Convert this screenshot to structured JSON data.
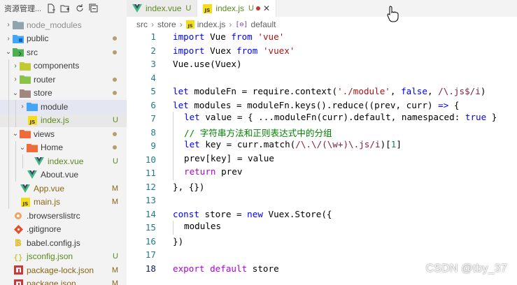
{
  "explorer": {
    "title": "资源管理...",
    "actions": [
      "new-file-icon",
      "new-folder-icon",
      "refresh-icon",
      "collapse-all-icon"
    ],
    "items": [
      {
        "label": "node_modules",
        "depth": 0,
        "kind": "folder",
        "open": false,
        "status": "",
        "color": "ignored"
      },
      {
        "label": "public",
        "depth": 0,
        "kind": "folder-public",
        "open": false,
        "status": "dot",
        "color": ""
      },
      {
        "label": "src",
        "depth": 0,
        "kind": "folder-src",
        "open": true,
        "status": "dot",
        "color": ""
      },
      {
        "label": "components",
        "depth": 1,
        "kind": "folder-components",
        "open": false,
        "status": "",
        "color": ""
      },
      {
        "label": "router",
        "depth": 1,
        "kind": "folder-router",
        "open": false,
        "status": "dot",
        "color": ""
      },
      {
        "label": "store",
        "depth": 1,
        "kind": "folder-store",
        "open": true,
        "status": "dot",
        "color": ""
      },
      {
        "label": "module",
        "depth": 2,
        "kind": "folder-module",
        "open": false,
        "status": "",
        "color": ""
      },
      {
        "label": "index.js",
        "depth": 2,
        "kind": "js",
        "open": false,
        "status": "U",
        "color": "git-u"
      },
      {
        "label": "views",
        "depth": 1,
        "kind": "folder-views",
        "open": true,
        "status": "dot",
        "color": ""
      },
      {
        "label": "Home",
        "depth": 2,
        "kind": "folder-home",
        "open": true,
        "status": "dot",
        "color": ""
      },
      {
        "label": "index.vue",
        "depth": 3,
        "kind": "vue",
        "open": false,
        "status": "U",
        "color": "git-u"
      },
      {
        "label": "About.vue",
        "depth": 2,
        "kind": "vue",
        "open": false,
        "status": "",
        "color": ""
      },
      {
        "label": "App.vue",
        "depth": 1,
        "kind": "vue",
        "open": false,
        "status": "M",
        "color": "git-m"
      },
      {
        "label": "main.js",
        "depth": 1,
        "kind": "js",
        "open": false,
        "status": "M",
        "color": "git-m"
      },
      {
        "label": ".browserslistrc",
        "depth": 0,
        "kind": "browserslist",
        "open": false,
        "status": "",
        "color": ""
      },
      {
        "label": ".gitignore",
        "depth": 0,
        "kind": "git",
        "open": false,
        "status": "",
        "color": ""
      },
      {
        "label": "babel.config.js",
        "depth": 0,
        "kind": "babel",
        "open": false,
        "status": "",
        "color": ""
      },
      {
        "label": "jsconfig.json",
        "depth": 0,
        "kind": "json",
        "open": false,
        "status": "U",
        "color": "git-u"
      },
      {
        "label": "package-lock.json",
        "depth": 0,
        "kind": "npm",
        "open": false,
        "status": "M",
        "color": "git-m"
      },
      {
        "label": "package.json",
        "depth": 0,
        "kind": "npm",
        "open": false,
        "status": "M",
        "color": "git-m"
      }
    ]
  },
  "tabs": [
    {
      "label": "index.vue",
      "status": "U",
      "icon": "vue-icon",
      "active": false
    },
    {
      "label": "index.js",
      "status": "U",
      "icon": "js-icon",
      "active": true
    }
  ],
  "breadcrumb": {
    "parts": [
      "src",
      "store",
      "index.js",
      "default"
    ]
  },
  "code": {
    "current_line": 18,
    "lines": [
      {
        "n": "1",
        "t": [
          [
            "kw",
            "import"
          ],
          [
            "",
            " Vue "
          ],
          [
            "kw",
            "from"
          ],
          [
            "",
            " "
          ],
          [
            "str",
            "'vue'"
          ]
        ]
      },
      {
        "n": "2",
        "t": [
          [
            "kw",
            "import"
          ],
          [
            "",
            " Vuex "
          ],
          [
            "kw",
            "from"
          ],
          [
            "",
            " "
          ],
          [
            "str",
            "'vuex'"
          ]
        ]
      },
      {
        "n": "3",
        "t": [
          [
            "",
            "Vue.use(Vuex)"
          ]
        ]
      },
      {
        "n": "4",
        "t": []
      },
      {
        "n": "5",
        "t": [
          [
            "kw",
            "let"
          ],
          [
            "",
            " moduleFn = require.context("
          ],
          [
            "str",
            "'./module'"
          ],
          [
            "",
            ", "
          ],
          [
            "kw",
            "false"
          ],
          [
            "",
            ", "
          ],
          [
            "rx",
            "/\\.js$/i"
          ],
          [
            "",
            ")"
          ]
        ]
      },
      {
        "n": "6",
        "t": [
          [
            "kw",
            "let"
          ],
          [
            "",
            " modules = moduleFn.keys().reduce((prev, curr) "
          ],
          [
            "kw",
            "=>"
          ],
          [
            "",
            " {"
          ]
        ]
      },
      {
        "n": "7",
        "t": [
          [
            "g",
            ""
          ],
          [
            "kw",
            "let"
          ],
          [
            "",
            " value = { ...moduleFn(curr).default, namespaced: "
          ],
          [
            "kw",
            "true"
          ],
          [
            "",
            " }"
          ]
        ]
      },
      {
        "n": "8",
        "t": [
          [
            "g",
            ""
          ],
          [
            "cm",
            "// 字符串方法和正则表达式中的分组"
          ]
        ]
      },
      {
        "n": "9",
        "t": [
          [
            "g",
            ""
          ],
          [
            "kw",
            "let"
          ],
          [
            "",
            " key = curr.match("
          ],
          [
            "rx",
            "/\\.\\/(\\w+)\\.js/i"
          ],
          [
            "",
            ")["
          ],
          [
            "num",
            "1"
          ],
          [
            "",
            "]"
          ]
        ]
      },
      {
        "n": "10",
        "t": [
          [
            "g",
            ""
          ],
          [
            "",
            "prev[key] = value"
          ]
        ]
      },
      {
        "n": "11",
        "t": [
          [
            "g",
            ""
          ],
          [
            "kw2",
            "return"
          ],
          [
            "",
            " prev"
          ]
        ]
      },
      {
        "n": "12",
        "t": [
          [
            "",
            "}, {})"
          ]
        ]
      },
      {
        "n": "13",
        "t": []
      },
      {
        "n": "14",
        "t": [
          [
            "kw",
            "const"
          ],
          [
            "",
            " store = "
          ],
          [
            "kw",
            "new"
          ],
          [
            "",
            " Vuex.Store({"
          ]
        ]
      },
      {
        "n": "15",
        "t": [
          [
            "g",
            ""
          ],
          [
            "",
            "modules"
          ]
        ]
      },
      {
        "n": "16",
        "t": [
          [
            "",
            "})"
          ]
        ]
      },
      {
        "n": "17",
        "t": []
      },
      {
        "n": "18",
        "t": [
          [
            "kw2",
            "export"
          ],
          [
            "",
            " "
          ],
          [
            "kw2",
            "default"
          ],
          [
            "",
            " store"
          ]
        ]
      }
    ]
  },
  "watermark": "CSDN @tby_37",
  "colors": {
    "git_untracked": "#5c8a1e",
    "git_modified": "#8a6414",
    "line_number": "#237893",
    "keyword": "#0000ff",
    "string": "#a31515",
    "comment": "#008000"
  }
}
